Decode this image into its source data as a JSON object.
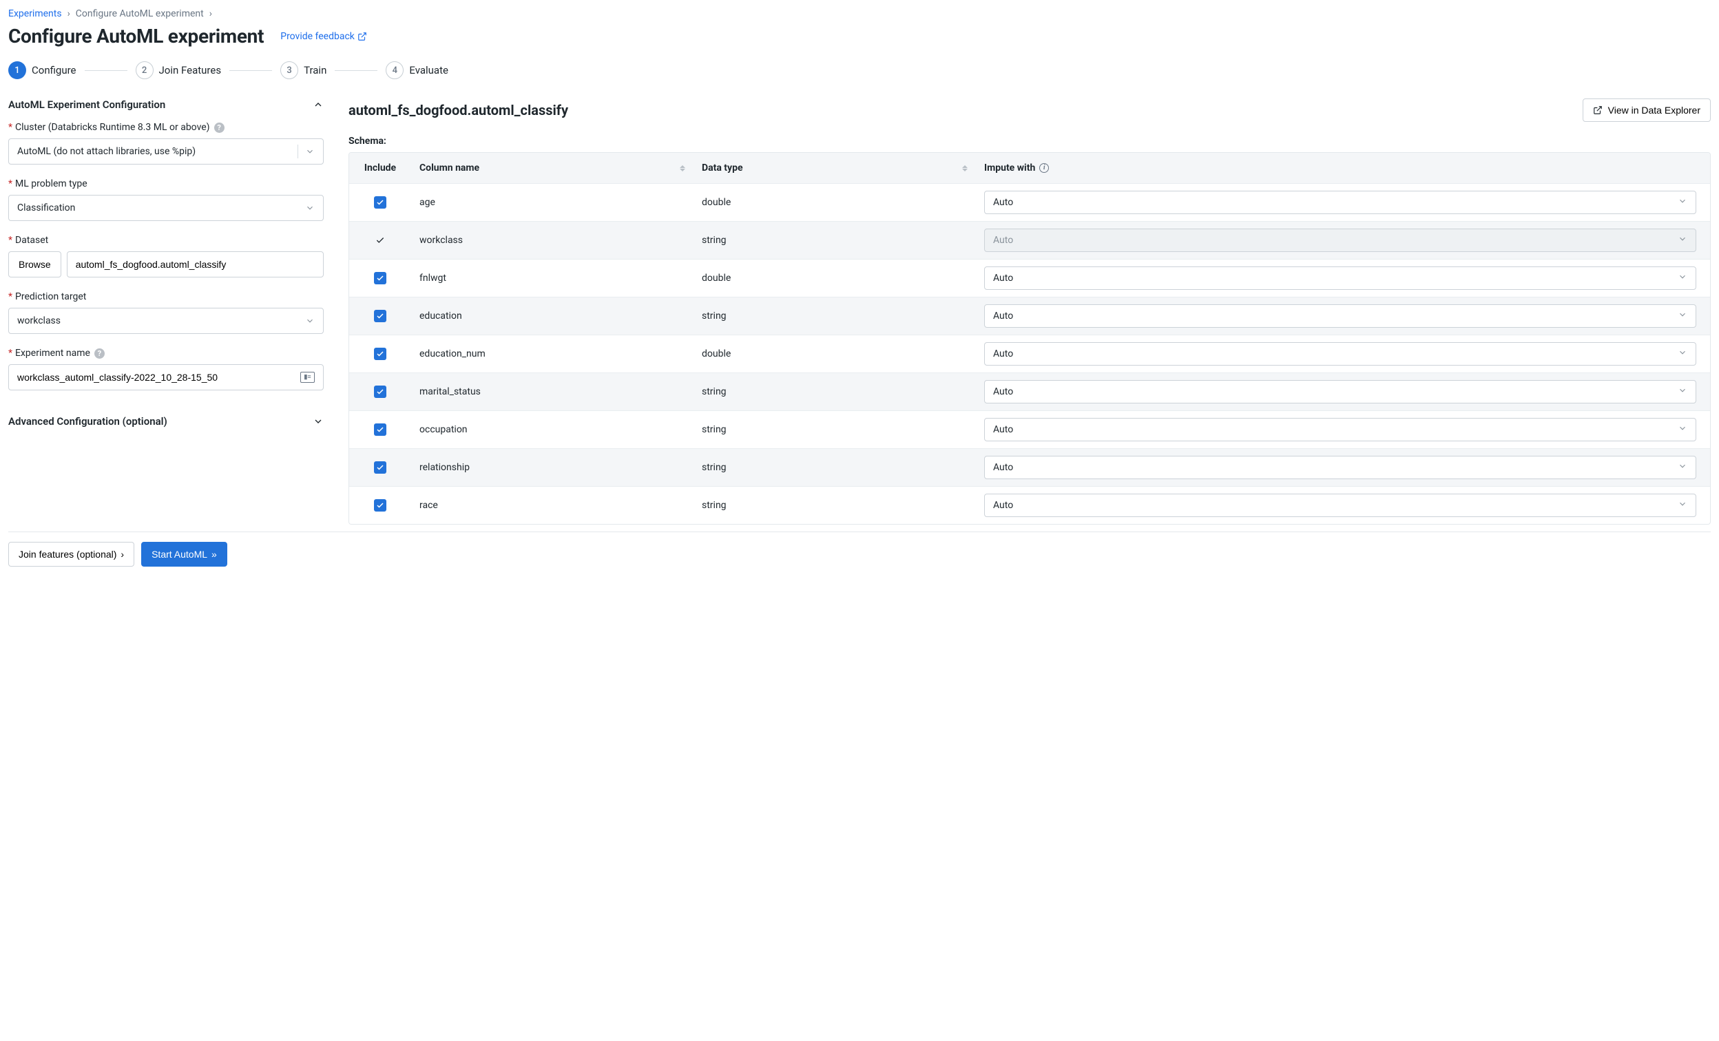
{
  "breadcrumb": {
    "root": "Experiments",
    "current": "Configure AutoML experiment"
  },
  "page_title": "Configure AutoML experiment",
  "feedback_link": "Provide feedback",
  "stepper": [
    {
      "num": "1",
      "label": "Configure",
      "active": true
    },
    {
      "num": "2",
      "label": "Join Features",
      "active": false
    },
    {
      "num": "3",
      "label": "Train",
      "active": false
    },
    {
      "num": "4",
      "label": "Evaluate",
      "active": false
    }
  ],
  "config_section_title": "AutoML Experiment Configuration",
  "cluster": {
    "label": "Cluster (Databricks Runtime 8.3 ML or above)",
    "value": "AutoML (do not attach libraries, use %pip)"
  },
  "problem_type": {
    "label": "ML problem type",
    "value": "Classification"
  },
  "dataset": {
    "label": "Dataset",
    "browse": "Browse",
    "value": "automl_fs_dogfood.automl_classify"
  },
  "target": {
    "label": "Prediction target",
    "value": "workclass"
  },
  "experiment_name": {
    "label": "Experiment name",
    "value": "workclass_automl_classify-2022_10_28-15_50"
  },
  "advanced_section_title": "Advanced Configuration (optional)",
  "right": {
    "title": "automl_fs_dogfood.automl_classify",
    "view_btn": "View in Data Explorer",
    "schema_label": "Schema:",
    "headers": {
      "include": "Include",
      "column": "Column name",
      "dtype": "Data type",
      "impute": "Impute with"
    },
    "rows": [
      {
        "column": "age",
        "dtype": "double",
        "impute": "Auto",
        "included": true,
        "is_target": false
      },
      {
        "column": "workclass",
        "dtype": "string",
        "impute": "Auto",
        "included": true,
        "is_target": true
      },
      {
        "column": "fnlwgt",
        "dtype": "double",
        "impute": "Auto",
        "included": true,
        "is_target": false
      },
      {
        "column": "education",
        "dtype": "string",
        "impute": "Auto",
        "included": true,
        "is_target": false
      },
      {
        "column": "education_num",
        "dtype": "double",
        "impute": "Auto",
        "included": true,
        "is_target": false
      },
      {
        "column": "marital_status",
        "dtype": "string",
        "impute": "Auto",
        "included": true,
        "is_target": false
      },
      {
        "column": "occupation",
        "dtype": "string",
        "impute": "Auto",
        "included": true,
        "is_target": false
      },
      {
        "column": "relationship",
        "dtype": "string",
        "impute": "Auto",
        "included": true,
        "is_target": false
      },
      {
        "column": "race",
        "dtype": "string",
        "impute": "Auto",
        "included": true,
        "is_target": false
      }
    ]
  },
  "footer": {
    "join": "Join features (optional)",
    "start": "Start AutoML"
  }
}
